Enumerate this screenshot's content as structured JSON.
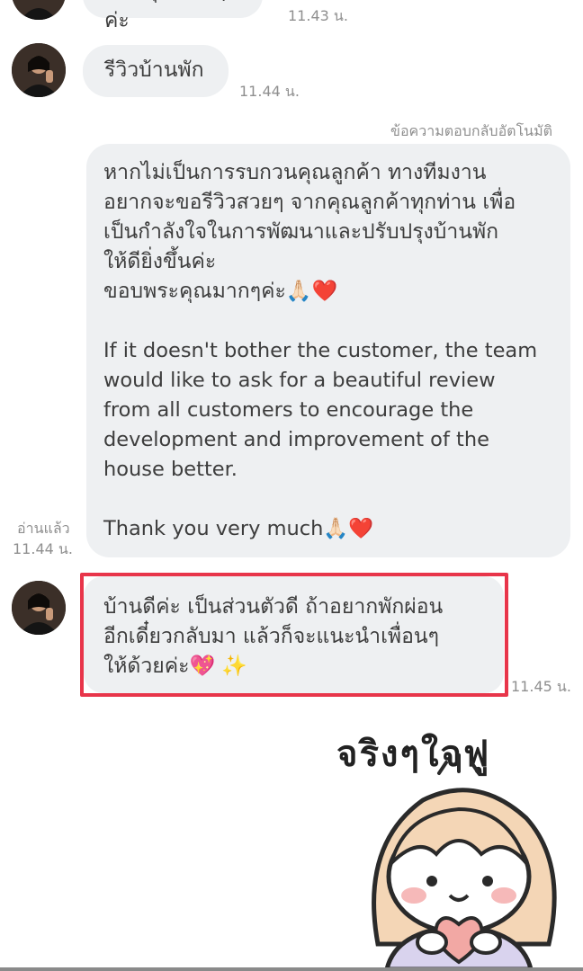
{
  "messages": {
    "top_partial": {
      "text": "ขอบคุณมากๆค่ะ",
      "time": "11.43 น."
    },
    "review_request": {
      "text": "รีวิวบ้านพัก",
      "time": "11.44 น."
    },
    "auto_reply_label": "ข้อความตอบกลับอัตโนมัติ",
    "auto_reply": {
      "text_th": "หากไม่เป็นการรบกวนคุณลูกค้า ทางทีมงาน\nอยากจะขอรีวิวสวยๆ จากคุณลูกค้าทุกท่าน เพื่อ\nเป็นกำลังใจในการพัฒนาและปรับปรุงบ้านพัก\nให้ดียิ่งขึ้นค่ะ\nขอบพระคุณมากๆค่ะ🙏🏻❤️",
      "text_en": "If it doesn't bother the customer, the team\nwould like to ask for a beautiful review\nfrom all customers to encourage the\ndevelopment and improvement of the\nhouse better.",
      "thanks_en": "Thank you very much🙏🏻❤️",
      "read_label": "อ่านแล้ว",
      "time": "11.44 น."
    },
    "customer_reply": {
      "text": "บ้านดีค่ะ เป็นส่วนตัวดี ถ้าอยากพักผ่อน\nอีกเดี๋ยวกลับมา แล้วก็จะแนะนำเพื่อนๆ\nให้ด้วยค่ะ💖 ✨",
      "time": "11.45 น."
    },
    "sticker": {
      "caption": "จริงๆใจฟู"
    }
  },
  "colors": {
    "bubble": "#eef0f2",
    "highlight": "#e8354a",
    "timestamp": "#8f8f8f"
  },
  "icons": [
    "avatar-image",
    "sticker-image"
  ]
}
